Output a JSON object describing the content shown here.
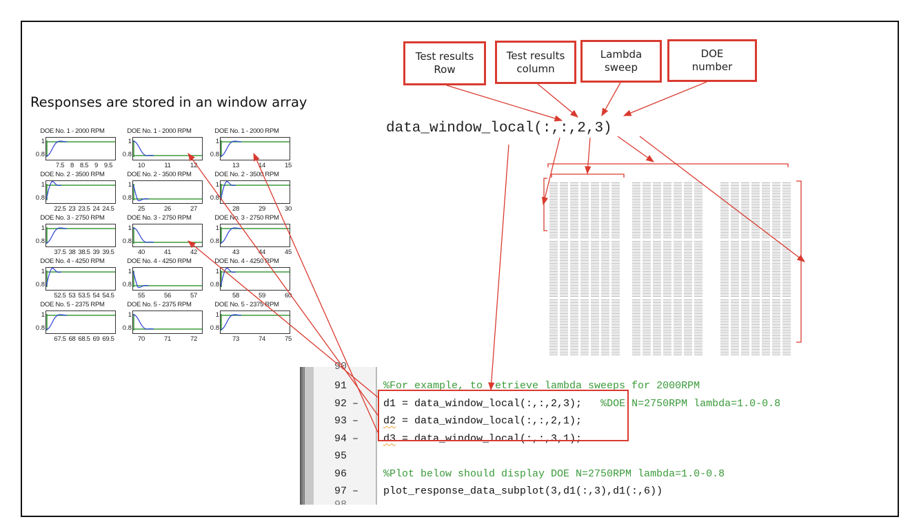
{
  "heading": "Responses are stored in an window array",
  "plots": {
    "rows": [
      {
        "title": "DOE No. 1 - 2000 RPM",
        "cols": [
          {
            "xticks": [
              "7.5",
              "8",
              "8.5",
              "9",
              "9.5"
            ],
            "type": "rise"
          },
          {
            "xticks": [
              "10",
              "11",
              "12"
            ],
            "type": "fall"
          },
          {
            "xticks": [
              "13",
              "14",
              "15"
            ],
            "type": "rise"
          }
        ]
      },
      {
        "title": "DOE No. 2 - 3500 RPM",
        "cols": [
          {
            "xticks": [
              "22.5",
              "23",
              "23.5",
              "24",
              "24.5"
            ],
            "type": "overshoot"
          },
          {
            "xticks": [
              "25",
              "26",
              "27"
            ],
            "type": "fallunder"
          },
          {
            "xticks": [
              "28",
              "29",
              "30"
            ],
            "type": "overshoot"
          }
        ]
      },
      {
        "title": "DOE No. 3 - 2750 RPM",
        "cols": [
          {
            "xticks": [
              "37.5",
              "38",
              "38.5",
              "39",
              "39.5"
            ],
            "type": "rise"
          },
          {
            "xticks": [
              "40",
              "41",
              "42"
            ],
            "type": "fall"
          },
          {
            "xticks": [
              "43",
              "44",
              "45"
            ],
            "type": "rise"
          }
        ]
      },
      {
        "title": "DOE No. 4 - 4250 RPM",
        "cols": [
          {
            "xticks": [
              "52.5",
              "53",
              "53.5",
              "54",
              "54.5"
            ],
            "type": "overshoot"
          },
          {
            "xticks": [
              "55",
              "56",
              "57"
            ],
            "type": "fallunder"
          },
          {
            "xticks": [
              "58",
              "59",
              "60"
            ],
            "type": "overshoot"
          }
        ]
      },
      {
        "title": "DOE No. 5 - 2375 RPM",
        "cols": [
          {
            "xticks": [
              "67.5",
              "68",
              "68.5",
              "69",
              "69.5"
            ],
            "type": "rise"
          },
          {
            "xticks": [
              "70",
              "71",
              "72"
            ],
            "type": "fall"
          },
          {
            "xticks": [
              "73",
              "74",
              "75"
            ],
            "type": "rise"
          }
        ]
      }
    ],
    "yticks": [
      "1",
      "0.8"
    ],
    "colors": {
      "response": "#2a3fd6",
      "reference": "#3c9a3c"
    }
  },
  "labels": [
    {
      "line1": "Test results",
      "line2": "Row"
    },
    {
      "line1": "Test results",
      "line2": "column"
    },
    {
      "line1": "Lambda",
      "line2": "sweep"
    },
    {
      "line1": "DOE",
      "line2": "number"
    }
  ],
  "expression": "data_window_local(:,:,2,3)",
  "editor": {
    "lines": [
      {
        "num": "91",
        "dash": "",
        "code": "",
        "comment": "%For example, to retrieve lambda sweeps for 2000RPM"
      },
      {
        "num": "92",
        "dash": "–",
        "var": "d1",
        "code": " = data_window_local(:,:,2,3);",
        "comment": "   %DOE N=2750RPM lambda=1.0-0.8"
      },
      {
        "num": "93",
        "dash": "–",
        "var": "d2",
        "code": " = data_window_local(:,:,2,1);",
        "comment": ""
      },
      {
        "num": "94",
        "dash": "–",
        "var": "d3",
        "code": " = data_window_local(:,:,3,1);",
        "comment": ""
      },
      {
        "num": "95",
        "dash": "",
        "code": "",
        "comment": ""
      },
      {
        "num": "96",
        "dash": "",
        "code": "",
        "comment": "%Plot below should display DOE N=2750RPM lambda=1.0-0.8"
      },
      {
        "num": "97",
        "dash": "–",
        "code": "plot_response_data_subplot(3,d1(:,3),d1(:,6))",
        "comment": ""
      }
    ]
  },
  "colors": {
    "annotation": "#d93a2f",
    "comment": "#3a9a3a",
    "frame": "#111111"
  }
}
